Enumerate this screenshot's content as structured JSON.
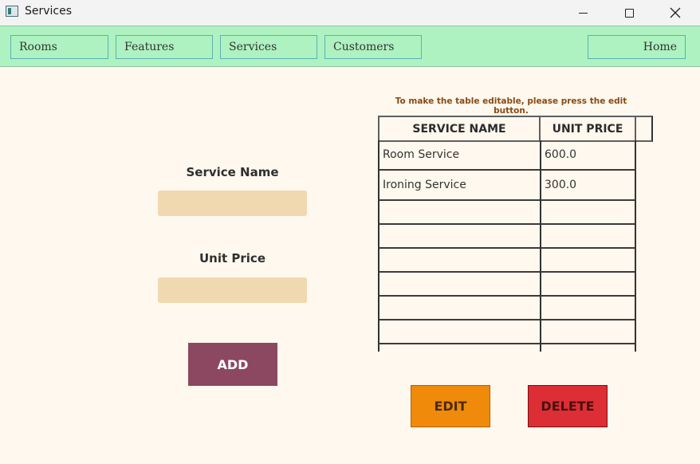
{
  "window": {
    "title": "Services",
    "icon": "app-window-icon",
    "controls": [
      "minimize-icon",
      "maximize-icon",
      "close-icon"
    ]
  },
  "menubar": {
    "rooms_label": "Rooms",
    "features_label": "Features",
    "services_label": "Services",
    "customers_label": "Customers",
    "home_label": "Home"
  },
  "form": {
    "service_name_label": "Service Name",
    "service_name_value": "",
    "unit_price_label": "Unit Price",
    "unit_price_value": "",
    "add_label": "ADD"
  },
  "table": {
    "note": "To make the table editable, please press the edit button.",
    "columns": [
      "SERVICE NAME",
      "UNIT PRICE"
    ],
    "rows": [
      [
        "Room Service",
        "600.0"
      ],
      [
        "Ironing Service",
        "300.0"
      ],
      [
        "",
        ""
      ],
      [
        "",
        ""
      ],
      [
        "",
        ""
      ],
      [
        "",
        ""
      ],
      [
        "",
        ""
      ],
      [
        "",
        ""
      ],
      [
        "",
        ""
      ]
    ]
  },
  "actions": {
    "edit_label": "EDIT",
    "delete_label": "DELETE"
  },
  "colors": {
    "background": "#fef8ee",
    "menubar": "#adf2c0",
    "input": "#f0d8b0",
    "add_button": "#8c4860",
    "edit_button": "#f08a0a",
    "delete_button": "#dc2e34",
    "note_text": "#8a4a12"
  }
}
